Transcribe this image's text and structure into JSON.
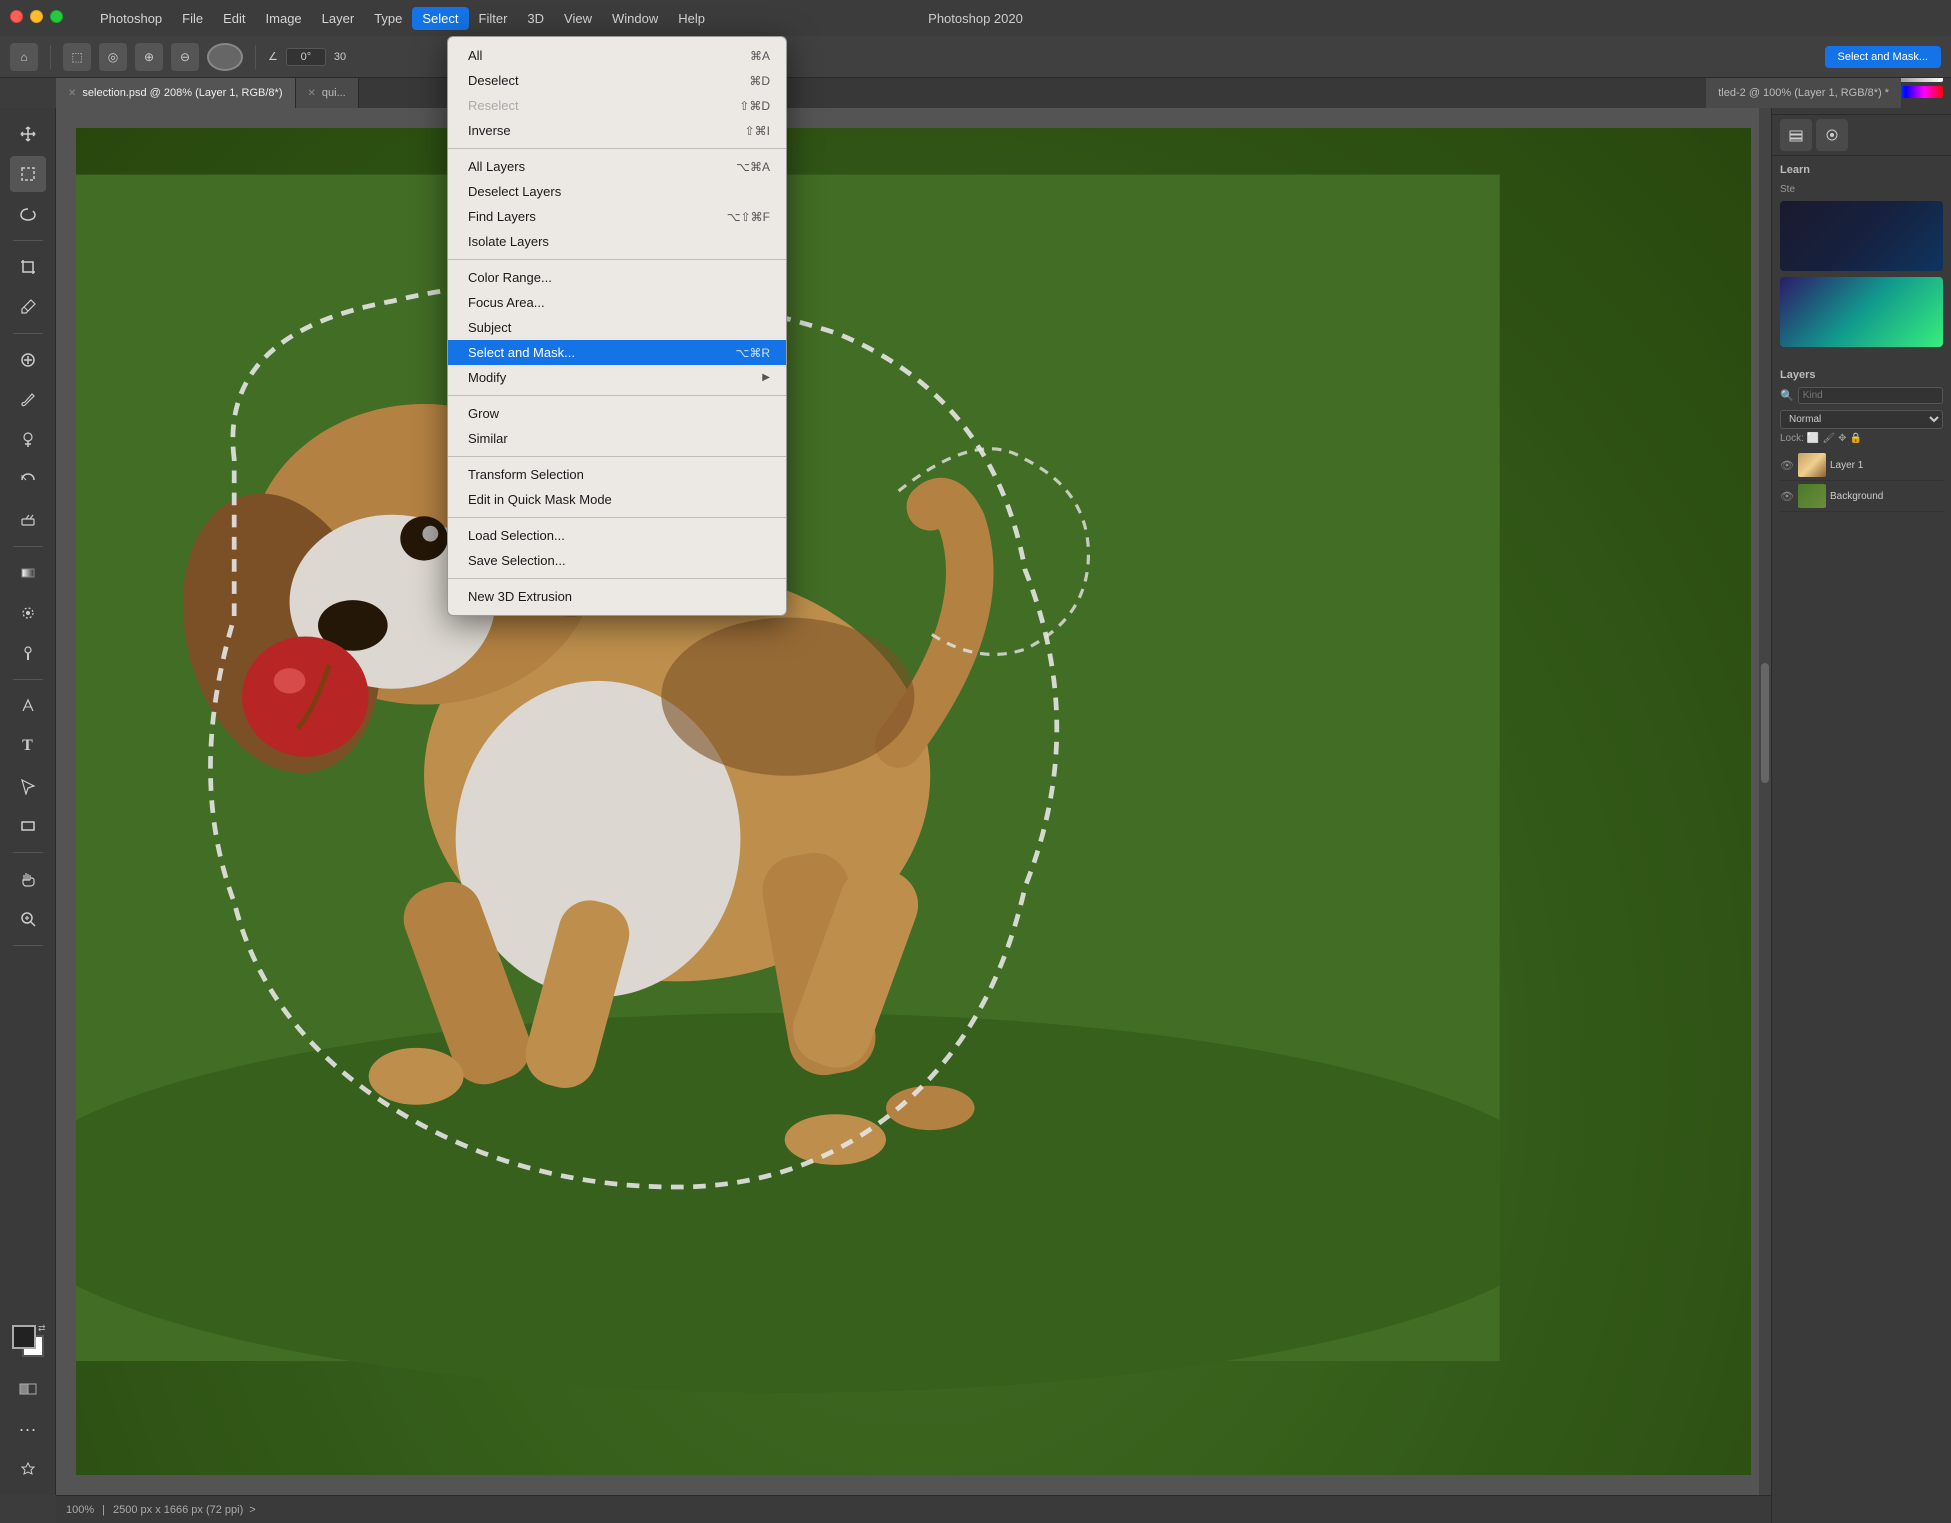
{
  "app": {
    "name": "Photoshop",
    "window_title": "Photoshop 2020"
  },
  "menu_bar": {
    "items": [
      {
        "label": "Photoshop",
        "active": false
      },
      {
        "label": "File",
        "active": false
      },
      {
        "label": "Edit",
        "active": false
      },
      {
        "label": "Image",
        "active": false
      },
      {
        "label": "Layer",
        "active": false
      },
      {
        "label": "Type",
        "active": false
      },
      {
        "label": "Select",
        "active": true
      },
      {
        "label": "Filter",
        "active": false
      },
      {
        "label": "3D",
        "active": false
      },
      {
        "label": "View",
        "active": false
      },
      {
        "label": "Window",
        "active": false
      },
      {
        "label": "Help",
        "active": false
      }
    ]
  },
  "options_bar": {
    "angle_value": "0°",
    "angle_label": "30",
    "select_mask_btn": "Select and Mask..."
  },
  "tabs": [
    {
      "title": "selection.psd @ 208% (Layer 1, RGB/8*)",
      "active": true,
      "closable": true
    },
    {
      "title": "qui...",
      "active": false,
      "closable": true
    }
  ],
  "active_doc_title": "tled-2 @ 100% (Layer 1, RGB/8*) *",
  "select_menu": {
    "items": [
      {
        "label": "All",
        "shortcut": "⌘A",
        "section": 1,
        "disabled": false
      },
      {
        "label": "Deselect",
        "shortcut": "⌘D",
        "section": 1,
        "disabled": false
      },
      {
        "label": "Reselect",
        "shortcut": "⇧⌘D",
        "section": 1,
        "disabled": true
      },
      {
        "label": "Inverse",
        "shortcut": "⇧⌘I",
        "section": 1,
        "disabled": false
      },
      {
        "label": "All Layers",
        "shortcut": "⌥⌘A",
        "section": 2,
        "disabled": false
      },
      {
        "label": "Deselect Layers",
        "shortcut": "",
        "section": 2,
        "disabled": false
      },
      {
        "label": "Find Layers",
        "shortcut": "⌥⇧⌘F",
        "section": 2,
        "disabled": false
      },
      {
        "label": "Isolate Layers",
        "shortcut": "",
        "section": 2,
        "disabled": false
      },
      {
        "label": "Color Range...",
        "shortcut": "",
        "section": 3,
        "disabled": false
      },
      {
        "label": "Focus Area...",
        "shortcut": "",
        "section": 3,
        "disabled": false
      },
      {
        "label": "Subject",
        "shortcut": "",
        "section": 3,
        "disabled": false
      },
      {
        "label": "Select and Mask...",
        "shortcut": "⌥⌘R",
        "section": 3,
        "highlighted": true,
        "disabled": false
      },
      {
        "label": "Modify",
        "shortcut": "",
        "section": 3,
        "has_arrow": true,
        "disabled": false
      },
      {
        "label": "Grow",
        "shortcut": "",
        "section": 4,
        "disabled": false
      },
      {
        "label": "Similar",
        "shortcut": "",
        "section": 4,
        "disabled": false
      },
      {
        "label": "Transform Selection",
        "shortcut": "",
        "section": 5,
        "disabled": false
      },
      {
        "label": "Edit in Quick Mask Mode",
        "shortcut": "",
        "section": 5,
        "disabled": false
      },
      {
        "label": "Load Selection...",
        "shortcut": "",
        "section": 6,
        "disabled": false
      },
      {
        "label": "Save Selection...",
        "shortcut": "",
        "section": 6,
        "disabled": false
      },
      {
        "label": "New 3D Extrusion",
        "shortcut": "",
        "section": 7,
        "disabled": false
      }
    ]
  },
  "right_panel": {
    "learn_title": "Learn",
    "steps_label": "Ste",
    "layers_title": "Layers",
    "kind_placeholder": "Kind",
    "blend_mode": "Normal",
    "lock_label": "Lock:",
    "layers": [
      {
        "name": "Layer 1",
        "type": "dog",
        "visible": true
      },
      {
        "name": "Background",
        "type": "bg",
        "visible": true
      }
    ]
  },
  "status_bar": {
    "zoom": "100%",
    "dimensions": "2500 px x 1666 px (72 ppi)",
    "arrow": ">"
  }
}
